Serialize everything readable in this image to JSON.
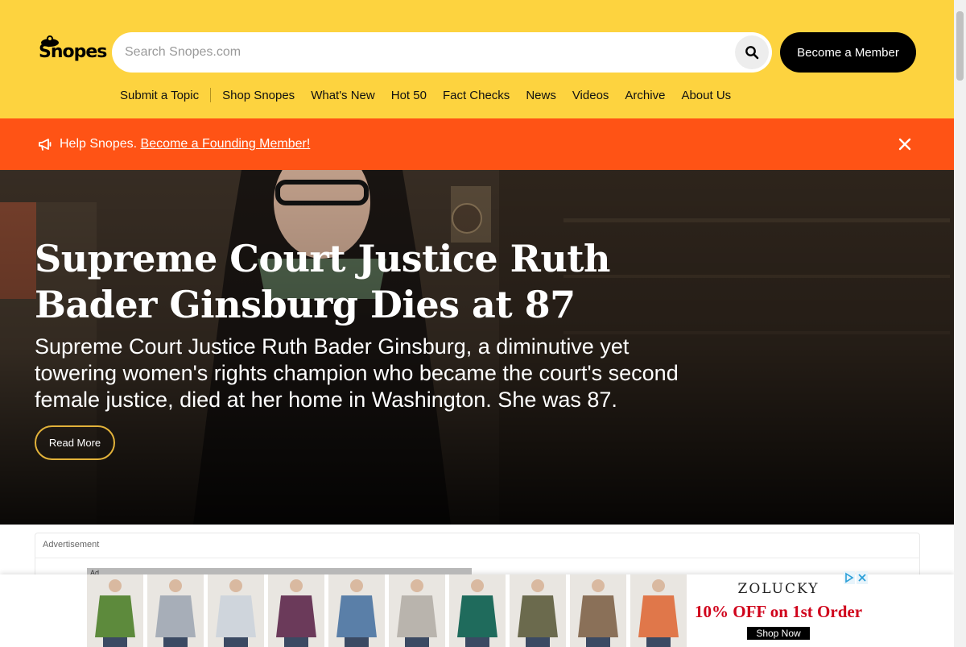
{
  "header": {
    "logo_text": "Snopes",
    "search_placeholder": "Search Snopes.com",
    "member_button": "Become a Member",
    "nav": [
      "Submit a Topic",
      "Shop Snopes",
      "What's New",
      "Hot 50",
      "Fact Checks",
      "News",
      "Videos",
      "Archive",
      "About Us"
    ]
  },
  "banner": {
    "prefix": "Help Snopes.",
    "link": "Become a Founding Member!"
  },
  "hero": {
    "title": "Supreme Court Justice Ruth Bader Ginsburg Dies at 87",
    "summary": "Supreme Court Justice Ruth Bader Ginsburg, a diminutive yet towering women's rights champion who became the court's second female justice, died at her home in Washington. She was 87.",
    "cta": "Read More"
  },
  "ad": {
    "label": "Advertisement",
    "tag": "Ad",
    "brand": "ZOLUCKY",
    "offer": "10% OFF on 1st Order",
    "shop_button": "Shop Now",
    "product_colors": [
      "#5d8a3c",
      "#a7aeb8",
      "#cfd5dc",
      "#6b3a5a",
      "#5a7fa8",
      "#b9b4ad",
      "#1f6b5c",
      "#6b6a4d",
      "#8a7058",
      "#e0774a"
    ]
  },
  "colors": {
    "header_bg": "#fdd33f",
    "banner_bg": "#ff5315",
    "accent_outline": "#e2b23a"
  }
}
